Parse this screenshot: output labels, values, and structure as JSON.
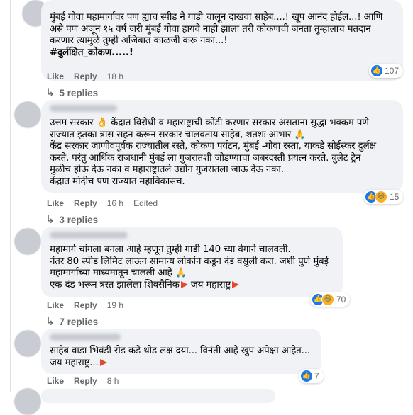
{
  "comments": [
    {
      "lines": [
        "मुंबई गोवा महामार्गावर पण ह्याच स्पीड ने गाडी चालून दाखवा साहेब....! खूप आनंद होईल...! आणि",
        "असे पण अजून १५ वर्ष जरी मुंबई गोवा हायवे नाही झाला तरी कोकणची जनता तुम्हालाच मतदान",
        "करणार त्यामुळे तुम्ही अजिबात काळजी करू नका...!"
      ],
      "hashtag": "#दुर्लक्षित_कोकण.....!",
      "like": "Like",
      "reply": "Reply",
      "time": "18 h",
      "reaction_count": "107",
      "replies_label": "5 replies"
    },
    {
      "lines": [
        "उत्तम सरकार 👌 केंद्रात विरोधी व महाराष्ट्राची कोंडी करणार सरकार असताना सुद्धा भक्कम पणे",
        "राज्यात इतका त्रास सहन करून सरकार चालवताय साहेब, शतशः आभार 🙏",
        "केंद्र सरकार जाणीवपूर्वक राज्यातील रस्ते, कोकण पर्यटन, मुंबई -गोवा रस्ता, याकडे सोईस्कर दुर्लक्ष",
        "करते, परंतु आर्थिक राजधानी मुंबई ला गुजरातशी जोडण्याचा जबरदस्ती प्रयत्न करते. बुलेट ट्रेन",
        "मुळीच होऊ देऊ नका व महाराष्ट्रातले उद्योग गुजरातला जाऊ देऊ नका.",
        "केंद्रात मोदीच पण राज्यात महाविकासच."
      ],
      "like": "Like",
      "reply": "Reply",
      "time": "16 h",
      "edited": "Edited",
      "reaction_count": "15",
      "replies_label": "3 replies"
    },
    {
      "lines": [
        "महामार्ग चांगला बनला आहे म्हणून तुम्ही गाडी 140 च्या वेगाने चालवली.",
        "नंतर 80 स्पीड लिमिट लाऊन सामान्य लोकांन कडून दंड वसुली करा. जशी पुणे मुंबई",
        "महामार्गाच्या माध्यमातून चालली आहे 🙏",
        "एक दंड भरून त्रस्त झालेला शिवसैनिक"
      ],
      "suffix": "जय महाराष्ट्र",
      "like": "Like",
      "reply": "Reply",
      "time": "19 h",
      "reaction_count": "70",
      "replies_label": "7 replies"
    },
    {
      "lines": [
        "साहेब वाडा भिवंडी रोड कडे थोड लक्ष दया... विनंती आहे खुप अपेक्षा आहेत...",
        "जय महाराष्ट्र..."
      ],
      "like": "Like",
      "reply": "Reply",
      "time": "8 h",
      "reaction_count": "7"
    }
  ],
  "colors": {
    "like_blue": "#1877f2",
    "flag_red": "#e4462f",
    "bubble": "#f0f2f5",
    "meta": "#65676b"
  },
  "icons": [
    "like-icon",
    "haha-icon",
    "reply-arrow-icon",
    "flag-icon"
  ]
}
